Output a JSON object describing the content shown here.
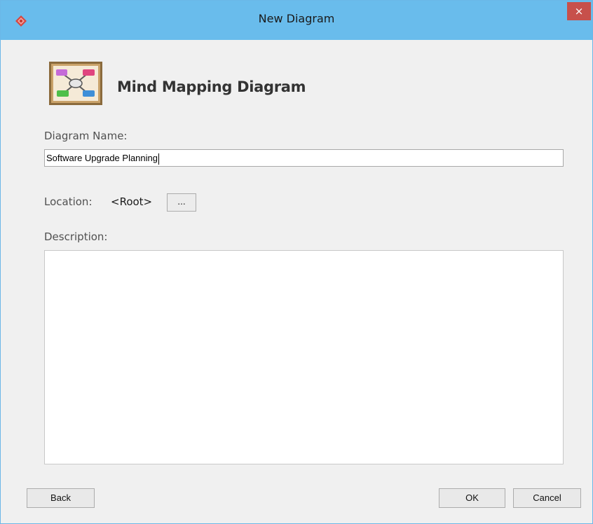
{
  "window": {
    "title": "New Diagram",
    "close_symbol": "×",
    "app_icon": "visual-paradigm-logo-icon"
  },
  "header": {
    "diagram_type": "Mind Mapping Diagram",
    "diagram_icon": "mind-map-diagram-icon"
  },
  "form": {
    "name_label": "Diagram Name:",
    "name_value": "Software Upgrade Planning",
    "location_label": "Location:",
    "location_value": "<Root>",
    "browse_label": "...",
    "description_label": "Description:",
    "description_value": ""
  },
  "buttons": {
    "back": "Back",
    "ok": "OK",
    "cancel": "Cancel"
  },
  "colors": {
    "titlebar": "#69bcec",
    "close_button": "#c7504b",
    "window_bg": "#f0f0f0"
  }
}
